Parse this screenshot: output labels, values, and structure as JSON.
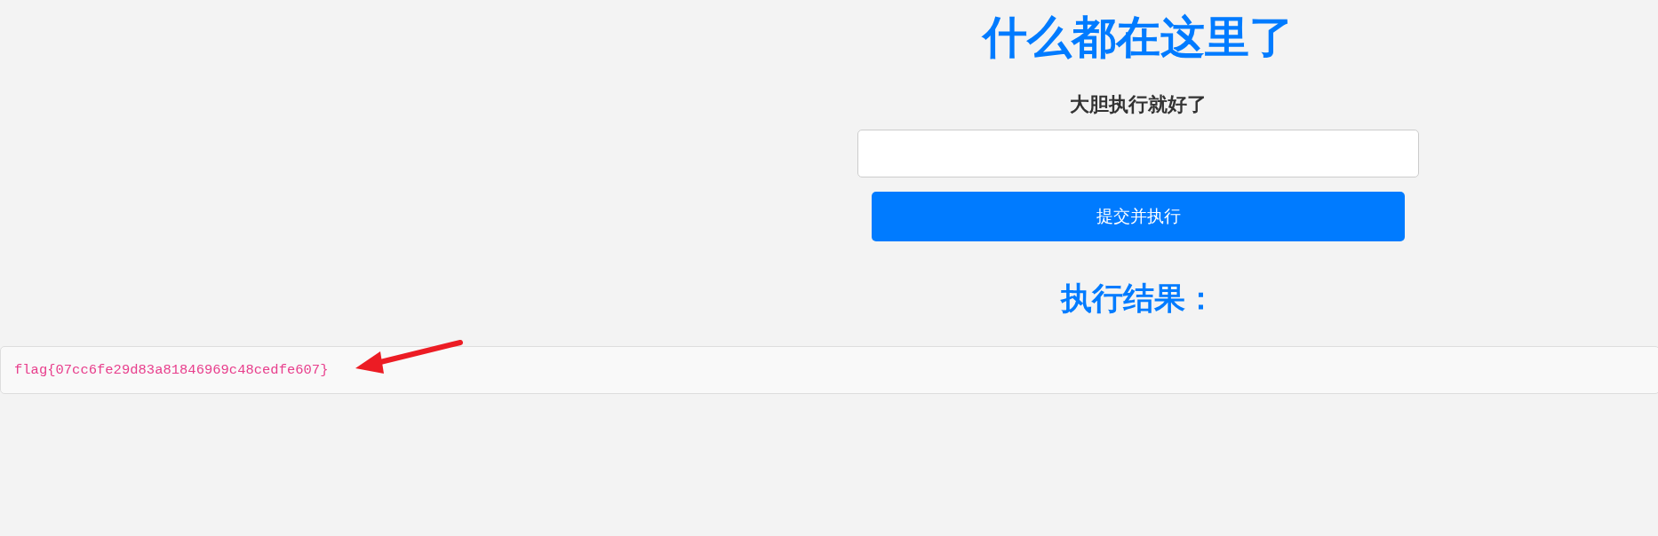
{
  "title": "什么都在这里了",
  "prompt": "大胆执行就好了",
  "submit_button": "提交并执行",
  "result_heading": "执行结果：",
  "result_output": "flag{07cc6fe29d83a81846969c48cedfe607}"
}
